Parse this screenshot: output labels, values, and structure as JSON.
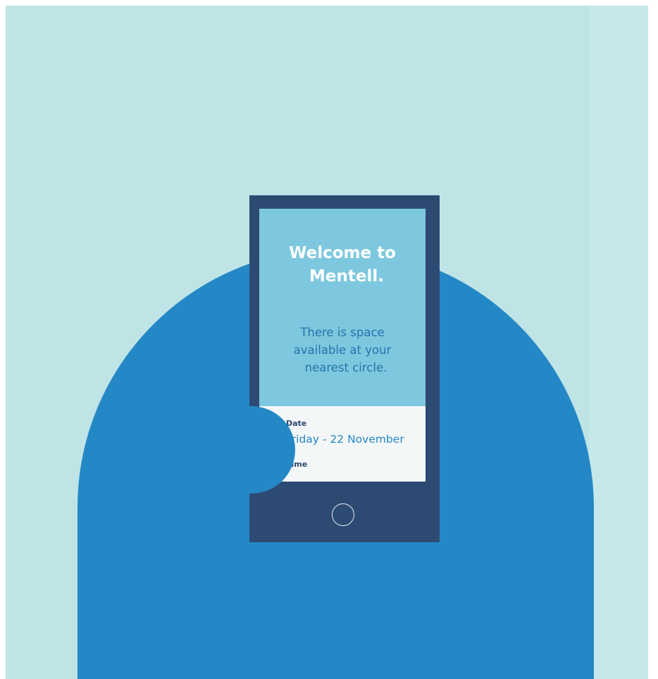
{
  "colors": {
    "background": "#bfe4e6",
    "arch": "#2588c6",
    "phone_body": "#2d4a72",
    "screen": "#7dc8de",
    "card": "#f4f7f8",
    "title_text": "#ffffff",
    "subtitle_text": "#2374ae"
  },
  "screen": {
    "title_line1": "Welcome to",
    "title_line2": "Mentell.",
    "subtitle_line1": "There is space",
    "subtitle_line2": "available at your",
    "subtitle_line3": "nearest circle."
  },
  "details": {
    "date_label": "Date",
    "date_value": "Friday - 22 November",
    "time_label": "Time"
  },
  "icons": {
    "home_button": "circle-outline-icon"
  }
}
